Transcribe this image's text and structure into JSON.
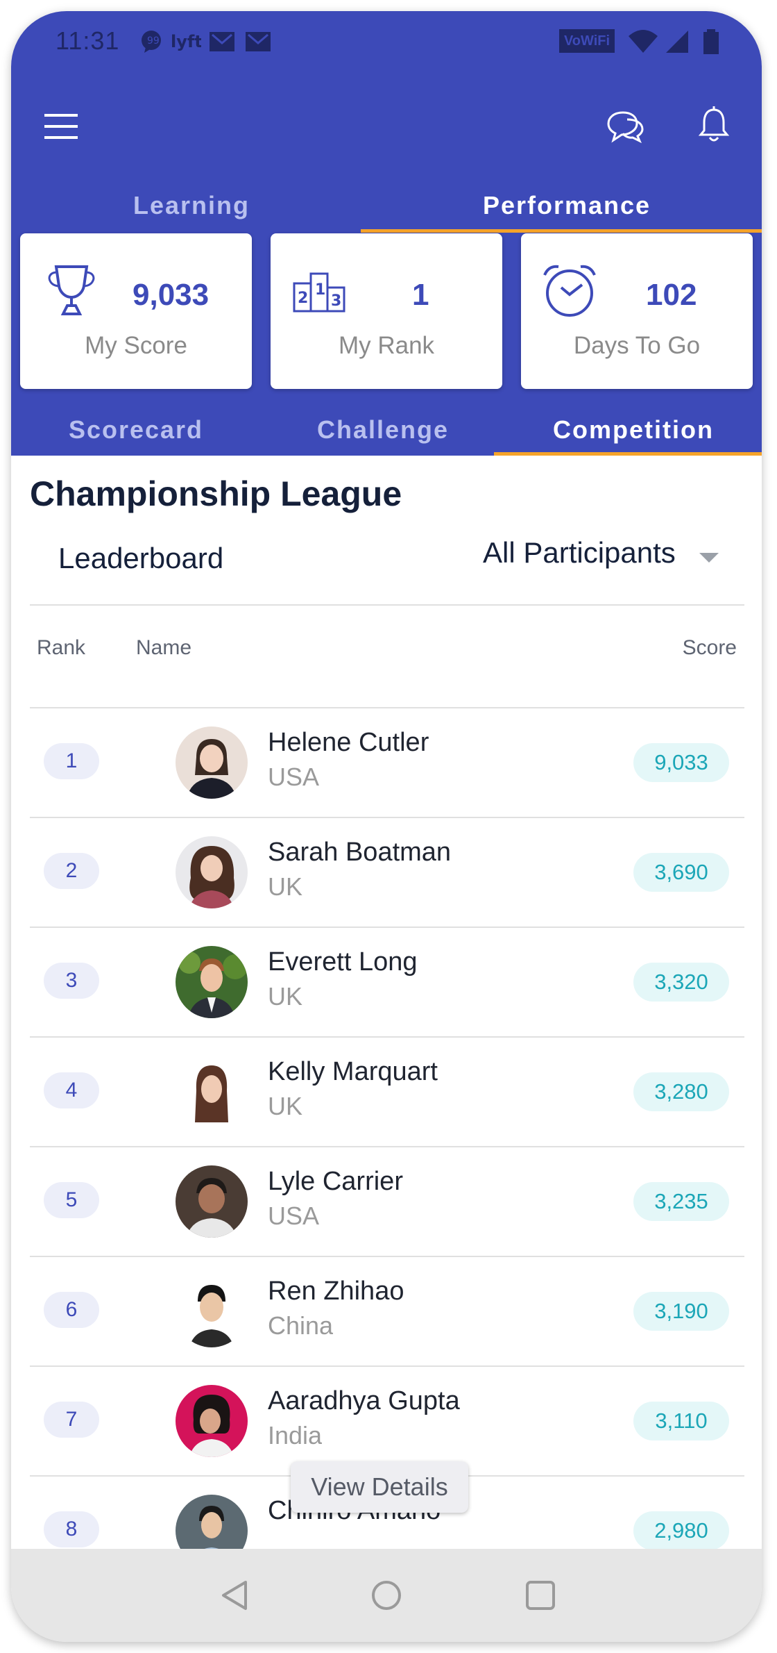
{
  "status_bar": {
    "time": "11:31",
    "wifi_label": "VoWiFi"
  },
  "tabs_top": [
    {
      "label": "Learning",
      "active": false
    },
    {
      "label": "Performance",
      "active": true
    }
  ],
  "stats": [
    {
      "icon": "trophy-icon",
      "value": "9,033",
      "label": "My Score"
    },
    {
      "icon": "podium-icon",
      "value": "1",
      "label": "My Rank"
    },
    {
      "icon": "alarm-clock-icon",
      "value": "102",
      "label": "Days To Go"
    }
  ],
  "tabs_sub": [
    {
      "label": "Scorecard",
      "active": false
    },
    {
      "label": "Challenge",
      "active": false
    },
    {
      "label": "Competition",
      "active": true
    }
  ],
  "league_title": "Championship League",
  "leaderboard_label": "Leaderboard",
  "filter": {
    "selected": "All Participants"
  },
  "table": {
    "headers": {
      "rank": "Rank",
      "name": "Name",
      "score": "Score"
    },
    "rows": [
      {
        "rank": "1",
        "name": "Helene Cutler",
        "country": "USA",
        "score": "9,033"
      },
      {
        "rank": "2",
        "name": "Sarah Boatman",
        "country": "UK",
        "score": "3,690"
      },
      {
        "rank": "3",
        "name": "Everett Long",
        "country": "UK",
        "score": "3,320"
      },
      {
        "rank": "4",
        "name": "Kelly Marquart",
        "country": "UK",
        "score": "3,280"
      },
      {
        "rank": "5",
        "name": "Lyle Carrier",
        "country": "USA",
        "score": "3,235"
      },
      {
        "rank": "6",
        "name": "Ren Zhihao",
        "country": "China",
        "score": "3,190"
      },
      {
        "rank": "7",
        "name": "Aaradhya Gupta",
        "country": "India",
        "score": "3,110"
      },
      {
        "rank": "8",
        "name": "Chihiro Amano",
        "country": "",
        "score": "2,980"
      }
    ]
  },
  "tooltip": "View Details",
  "colors": {
    "primary": "#3d4ab8",
    "accent": "#f5a32a",
    "score_text": "#1ba6b7"
  }
}
